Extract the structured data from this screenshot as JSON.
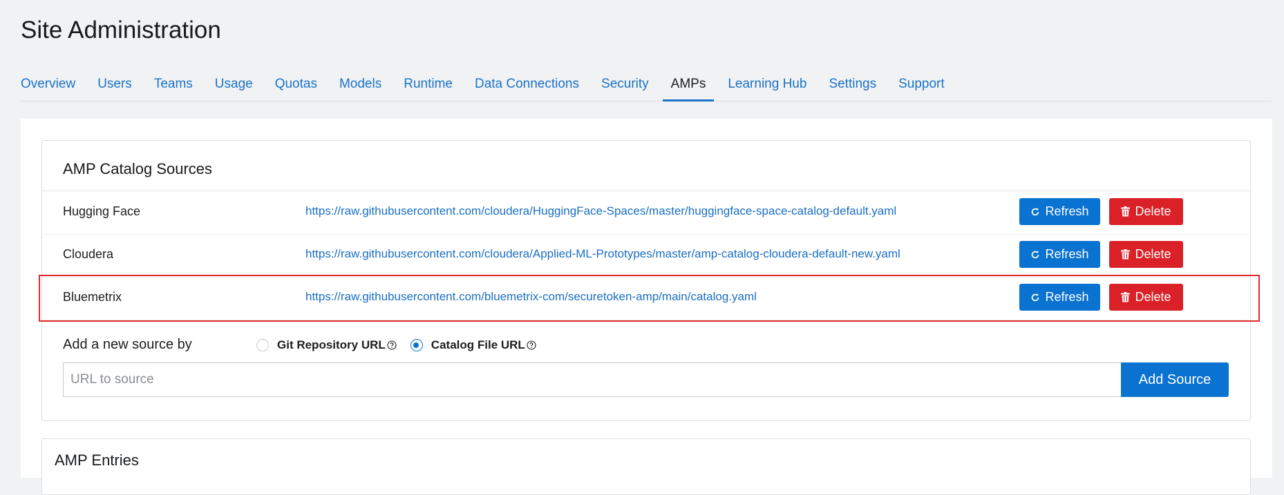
{
  "page": {
    "title": "Site Administration"
  },
  "tabs": [
    {
      "label": "Overview",
      "active": false
    },
    {
      "label": "Users",
      "active": false
    },
    {
      "label": "Teams",
      "active": false
    },
    {
      "label": "Usage",
      "active": false
    },
    {
      "label": "Quotas",
      "active": false
    },
    {
      "label": "Models",
      "active": false
    },
    {
      "label": "Runtime",
      "active": false
    },
    {
      "label": "Data Connections",
      "active": false
    },
    {
      "label": "Security",
      "active": false
    },
    {
      "label": "AMPs",
      "active": true
    },
    {
      "label": "Learning Hub",
      "active": false
    },
    {
      "label": "Settings",
      "active": false
    },
    {
      "label": "Support",
      "active": false
    }
  ],
  "catalog": {
    "title": "AMP Catalog Sources",
    "refresh_label": "Refresh",
    "delete_label": "Delete",
    "sources": [
      {
        "name": "Hugging Face",
        "url": "https://raw.githubusercontent.com/cloudera/HuggingFace-Spaces/master/huggingface-space-catalog-default.yaml"
      },
      {
        "name": "Cloudera",
        "url": "https://raw.githubusercontent.com/cloudera/Applied-ML-Prototypes/master/amp-catalog-cloudera-default-new.yaml"
      },
      {
        "name": "Bluemetrix",
        "url": "https://raw.githubusercontent.com/bluemetrix-com/securetoken-amp/main/catalog.yaml"
      }
    ],
    "add_source": {
      "label": "Add a new source by",
      "options": [
        {
          "label": "Git Repository URL",
          "checked": false
        },
        {
          "label": "Catalog File URL",
          "checked": true
        }
      ],
      "placeholder": "URL to source",
      "value": "",
      "button_label": "Add Source"
    }
  },
  "entries": {
    "title": "AMP Entries"
  },
  "colors": {
    "primary": "#0a72d0",
    "danger": "#d92127",
    "highlight": "#e02a2a"
  }
}
